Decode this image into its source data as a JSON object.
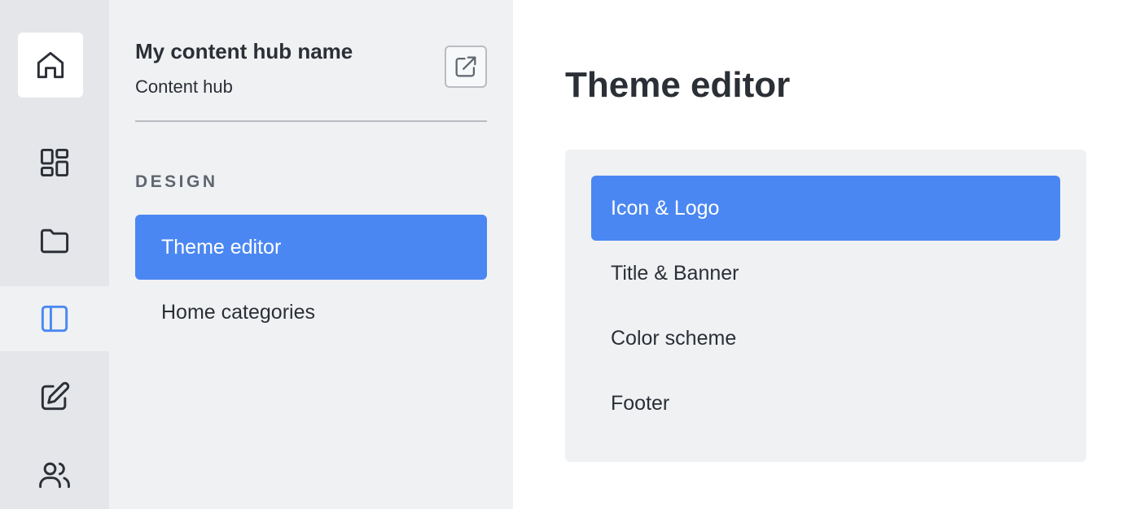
{
  "rail": {
    "items": [
      {
        "icon": "home-icon",
        "active": false
      },
      {
        "icon": "dashboard-icon",
        "active": false
      },
      {
        "icon": "folder-icon",
        "active": false
      },
      {
        "icon": "layout-sidebar-icon",
        "active": true
      },
      {
        "icon": "edit-icon",
        "active": false
      },
      {
        "icon": "users-icon",
        "active": false
      }
    ]
  },
  "sidebar": {
    "hub_name": "My content hub name",
    "hub_subtitle": "Content hub",
    "external_link_icon": "external-link-icon",
    "section_label": "DESIGN",
    "items": [
      {
        "label": "Theme editor",
        "active": true
      },
      {
        "label": "Home categories",
        "active": false
      }
    ]
  },
  "main": {
    "title": "Theme editor",
    "items": [
      {
        "label": "Icon & Logo",
        "active": true
      },
      {
        "label": "Title & Banner",
        "active": false
      },
      {
        "label": "Color scheme",
        "active": false
      },
      {
        "label": "Footer",
        "active": false
      }
    ]
  },
  "colors": {
    "accent": "#4b87f2",
    "rail_bg": "#e4e6e9",
    "sidebar_bg": "#f0f1f3",
    "text": "#2b2f36",
    "muted": "#5f6670",
    "active_icon": "#4b87f2"
  }
}
